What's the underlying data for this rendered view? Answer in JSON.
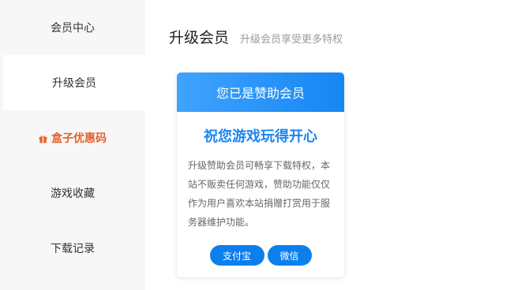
{
  "sidebar": {
    "items": [
      {
        "label": "会员中心"
      },
      {
        "label": "升级会员"
      },
      {
        "label": "盒子优惠码",
        "icon": "gift-icon",
        "color": "#e8602c"
      },
      {
        "label": "游戏收藏"
      },
      {
        "label": "下载记录"
      }
    ]
  },
  "header": {
    "title": "升级会员",
    "subtitle": "升级会员享受更多特权"
  },
  "card": {
    "status": "您已是赞助会员",
    "headline": "祝您游戏玩得开心",
    "description": "升级赞助会员可畅享下载特权，本站不贩卖任何游戏，赞助功能仅仅作为用户喜欢本站捐赠打赏用于服务器维护功能。",
    "buttons": {
      "alipay": "支付宝",
      "wechat": "微信"
    }
  },
  "colors": {
    "accent": "#1a86f0",
    "button": "#0d7fec",
    "promo": "#e8602c"
  }
}
